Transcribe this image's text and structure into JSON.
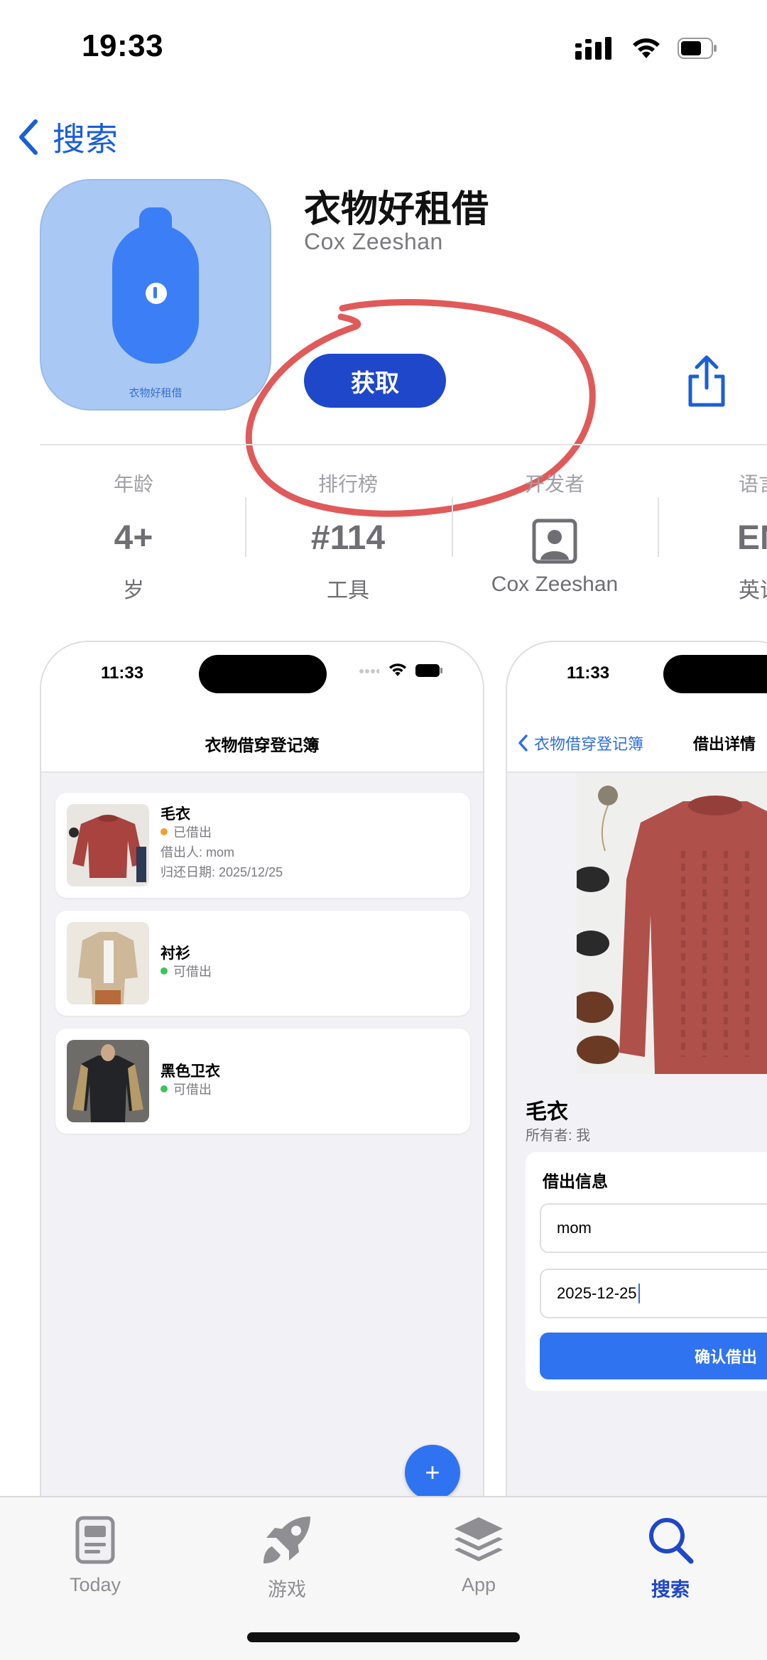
{
  "status_bar": {
    "time": "19:33"
  },
  "nav": {
    "back_label": "搜索"
  },
  "app": {
    "title": "衣物好租借",
    "developer": "Cox Zeeshan",
    "icon_caption": "衣物好租借",
    "get_label": "获取"
  },
  "info": [
    {
      "label": "年龄",
      "value": "4+",
      "sub": "岁"
    },
    {
      "label": "排行榜",
      "value": "#114",
      "sub": "工具"
    },
    {
      "label": "开发者",
      "value": "",
      "sub": "Cox Zeeshan"
    },
    {
      "label": "语言",
      "value": "EN",
      "sub": "英语"
    }
  ],
  "screenshot1": {
    "time": "11:33",
    "title": "衣物借穿登记簿",
    "items": [
      {
        "name": "毛衣",
        "status": "已借出",
        "status_color": "#f0a030",
        "borrower": "借出人: mom",
        "return_date": "归还日期: 2025/12/25"
      },
      {
        "name": "衬衫",
        "status": "可借出",
        "status_color": "#3cc45a"
      },
      {
        "name": "黑色卫衣",
        "status": "可借出",
        "status_color": "#3cc45a"
      }
    ],
    "fab_label": "+"
  },
  "screenshot2": {
    "time": "11:33",
    "back_label": "衣物借穿登记簿",
    "title": "借出详情",
    "item_name": "毛衣",
    "owner": "所有者: 我",
    "lend_section_title": "借出信息",
    "borrower_value": "mom",
    "date_value": "2025-12-25",
    "confirm_label": "确认借出"
  },
  "tabs": [
    {
      "label": "Today",
      "icon": "today-icon",
      "active": false
    },
    {
      "label": "游戏",
      "icon": "rocket-icon",
      "active": false
    },
    {
      "label": "App",
      "icon": "layers-icon",
      "active": false
    },
    {
      "label": "搜索",
      "icon": "search-icon",
      "active": true
    }
  ],
  "colors": {
    "accent": "#1f47c9",
    "link": "#1a5fd6",
    "annotation": "#e05a5a"
  }
}
